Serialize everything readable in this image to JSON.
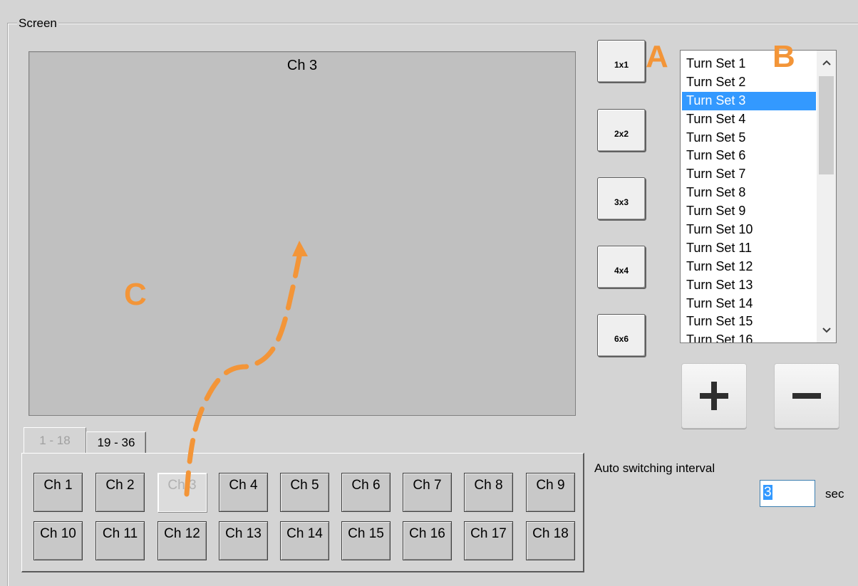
{
  "group": {
    "title": "Screen"
  },
  "preview": {
    "channel_title": "Ch 3"
  },
  "split_buttons": [
    {
      "label": "1x1"
    },
    {
      "label": "2x2"
    },
    {
      "label": "3x3"
    },
    {
      "label": "4x4"
    },
    {
      "label": "6x6"
    }
  ],
  "turn_sets": {
    "items": [
      "Turn Set  1",
      "Turn Set  2",
      "Turn Set  3",
      "Turn Set  4",
      "Turn Set  5",
      "Turn Set  6",
      "Turn Set  7",
      "Turn Set  8",
      "Turn Set  9",
      "Turn Set  10",
      "Turn Set  11",
      "Turn Set  12",
      "Turn Set  13",
      "Turn Set  14",
      "Turn Set  15",
      "Turn Set  16"
    ],
    "selected_index": 2
  },
  "channel_tabs": [
    {
      "label": "1 - 18",
      "active": true
    },
    {
      "label": "19 - 36",
      "active": false
    }
  ],
  "channels": [
    {
      "label": "Ch 1"
    },
    {
      "label": "Ch 2"
    },
    {
      "label": "Ch 3",
      "disabled": true
    },
    {
      "label": "Ch 4"
    },
    {
      "label": "Ch 5"
    },
    {
      "label": "Ch 6"
    },
    {
      "label": "Ch 7"
    },
    {
      "label": "Ch 8"
    },
    {
      "label": "Ch 9"
    },
    {
      "label": "Ch 10"
    },
    {
      "label": "Ch 11"
    },
    {
      "label": "Ch 12"
    },
    {
      "label": "Ch 13"
    },
    {
      "label": "Ch 14"
    },
    {
      "label": "Ch 15"
    },
    {
      "label": "Ch 16"
    },
    {
      "label": "Ch 17"
    },
    {
      "label": "Ch 18"
    }
  ],
  "auto_switch": {
    "label": "Auto switching interval",
    "value": "3",
    "unit": "sec"
  },
  "annotations": {
    "a": "A",
    "b": "B",
    "c": "C",
    "color": "#f39538"
  },
  "icons": {
    "plus": "plus-icon",
    "minus": "minus-icon",
    "scroll_up": "chevron-up-icon",
    "scroll_down": "chevron-down-icon"
  }
}
